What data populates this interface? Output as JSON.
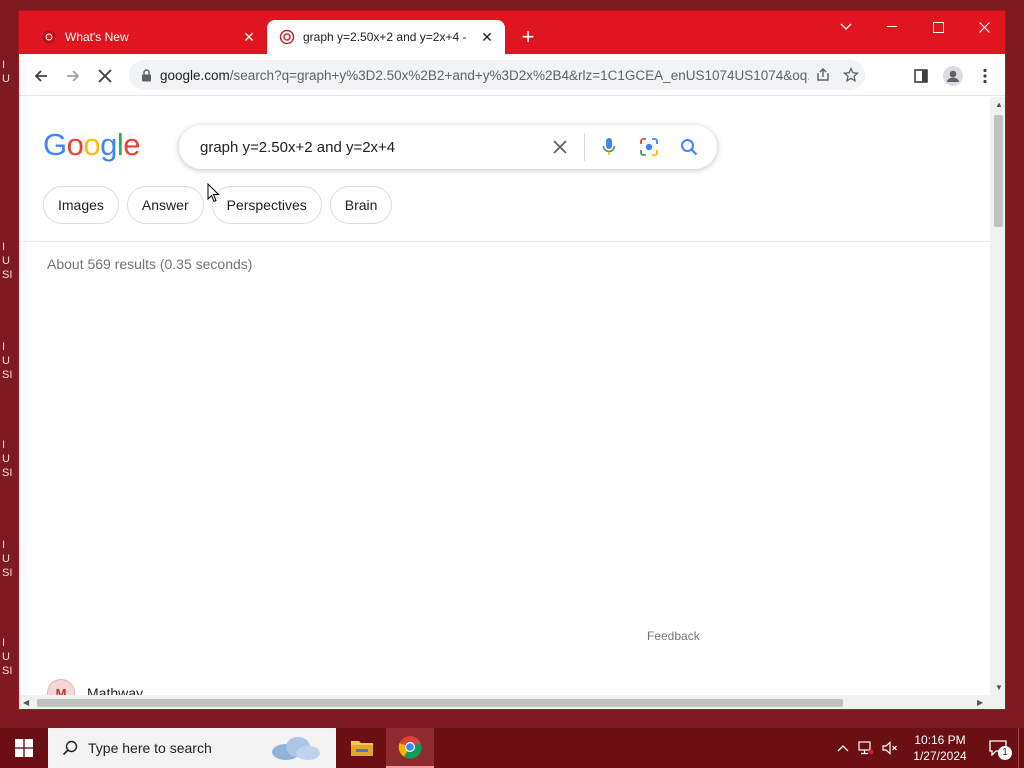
{
  "desktop": {
    "labels": [
      "I\nU",
      "I\nU\nSI",
      "I\nU\nSI",
      "I\nU\nSI",
      "I\nU\nSI",
      "I\nU\nSI"
    ]
  },
  "browser": {
    "tabs": [
      {
        "title": "What's New",
        "active": false
      },
      {
        "title": "graph y=2.50x+2 and y=2x+4 -",
        "active": true
      }
    ],
    "new_tab_label": "+",
    "address": {
      "host": "google.com",
      "path": "/search?q=graph+y%3D2.50x%2B2+and+y%3D2x%2B4&rlz=1C1GCEA_enUS1074US1074&oq..."
    }
  },
  "google": {
    "logo_text": "Google",
    "query": "graph y=2.50x+2 and y=2x+4",
    "chips": [
      "Images",
      "Answer",
      "Perspectives",
      "Brain"
    ],
    "result_stats": "About 569 results (0.35 seconds)",
    "feedback_label": "Feedback",
    "first_result_site": "Mathway",
    "first_result_icon_letter": "M"
  },
  "taskbar": {
    "search_placeholder": "Type here to search",
    "time": "10:16 PM",
    "date": "1/27/2024",
    "notification_count": "1"
  },
  "colors": {
    "titlebar": "#e0151f",
    "desktop": "#7d1b20",
    "taskbar": "#6b0f13",
    "google_blue": "#4285f4",
    "google_red": "#ea4335",
    "google_yellow": "#fbbc05",
    "google_green": "#34a853"
  }
}
